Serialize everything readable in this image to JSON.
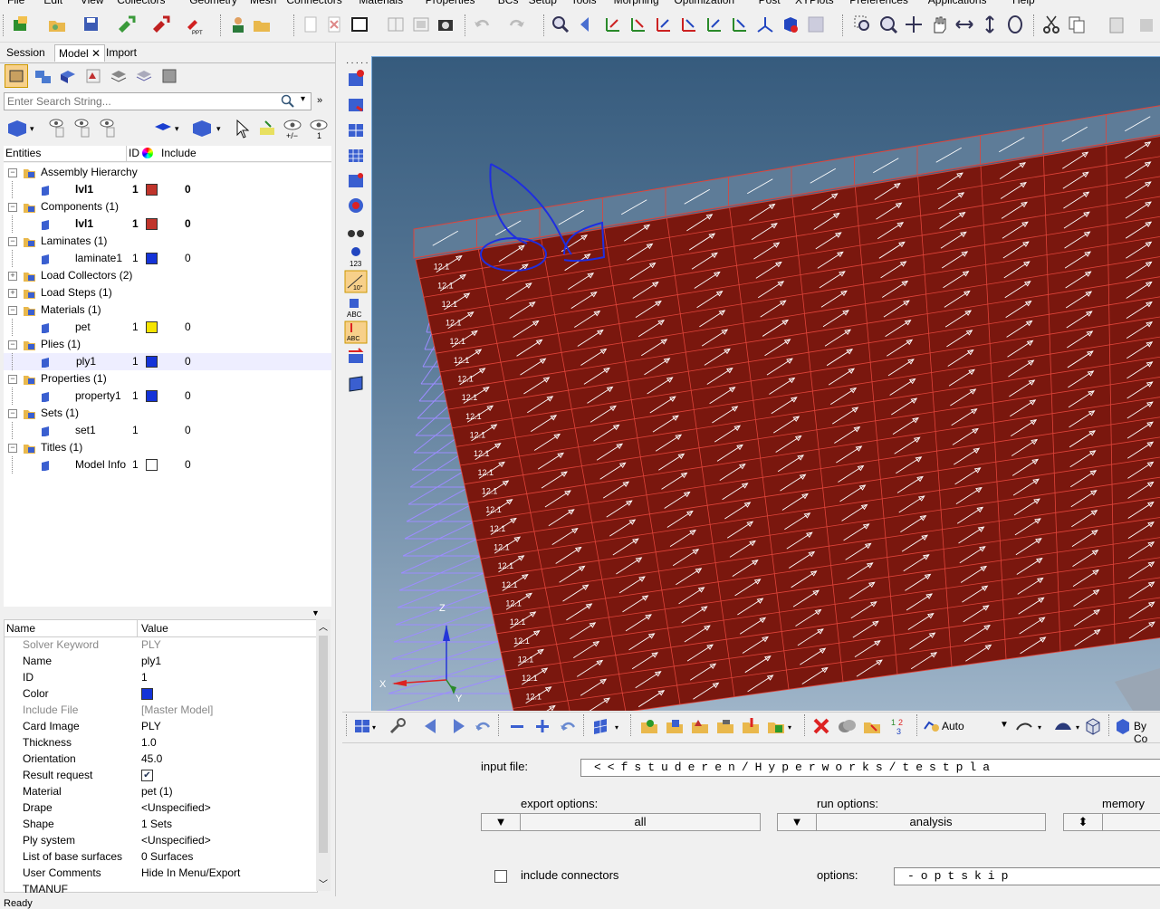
{
  "menus": [
    "File",
    "Edit",
    "View",
    "Collectors",
    "Geometry",
    "Mesh",
    "Connectors",
    "Materials",
    "Properties",
    "BCs",
    "Setup",
    "Tools",
    "Morphing",
    "Optimization",
    "Post",
    "XYPlots",
    "Preferences",
    "Applications",
    "Help"
  ],
  "tabs": {
    "session": "Session",
    "model": "Model",
    "import": "Import"
  },
  "search": {
    "placeholder": "Enter Search String..."
  },
  "columns": {
    "entities": "Entities",
    "id": "ID",
    "include": "Include"
  },
  "tree": [
    {
      "label": "Assembly Hierarchy",
      "level": 0,
      "id": "",
      "include": "",
      "color": ""
    },
    {
      "label": "lvl1",
      "level": 1,
      "id": "1",
      "include": "0",
      "color": "#c0342b",
      "bold": true
    },
    {
      "label": "Components (1)",
      "level": 0,
      "id": "",
      "include": "",
      "color": ""
    },
    {
      "label": "lvl1",
      "level": 1,
      "id": "1",
      "include": "0",
      "color": "#c0342b",
      "bold": true
    },
    {
      "label": "Laminates (1)",
      "level": 0,
      "id": "",
      "include": "",
      "color": ""
    },
    {
      "label": "laminate1",
      "level": 1,
      "id": "1",
      "include": "0",
      "color": "#1433d8"
    },
    {
      "label": "Load Collectors (2)",
      "level": 0,
      "id": "",
      "include": "",
      "color": ""
    },
    {
      "label": "Load Steps (1)",
      "level": 0,
      "id": "",
      "include": "",
      "color": ""
    },
    {
      "label": "Materials (1)",
      "level": 0,
      "id": "",
      "include": "",
      "color": ""
    },
    {
      "label": "pet",
      "level": 1,
      "id": "1",
      "include": "0",
      "color": "#f5e400"
    },
    {
      "label": "Plies (1)",
      "level": 0,
      "id": "",
      "include": "",
      "color": ""
    },
    {
      "label": "ply1",
      "level": 1,
      "id": "1",
      "include": "0",
      "color": "#1433d8",
      "selected": true
    },
    {
      "label": "Properties (1)",
      "level": 0,
      "id": "",
      "include": "",
      "color": ""
    },
    {
      "label": "property1",
      "level": 1,
      "id": "1",
      "include": "0",
      "color": "#1433d8"
    },
    {
      "label": "Sets (1)",
      "level": 0,
      "id": "",
      "include": "",
      "color": ""
    },
    {
      "label": "set1",
      "level": 1,
      "id": "1",
      "include": "0",
      "color": ""
    },
    {
      "label": "Titles (1)",
      "level": 0,
      "id": "",
      "include": "",
      "color": ""
    },
    {
      "label": "Model Info",
      "level": 1,
      "id": "1",
      "include": "0",
      "color": "#ffffff"
    }
  ],
  "props_header": {
    "name": "Name",
    "value": "Value"
  },
  "props": [
    {
      "name": "Solver Keyword",
      "value": "PLY",
      "grey": true
    },
    {
      "name": "Name",
      "value": "ply1"
    },
    {
      "name": "ID",
      "value": "1"
    },
    {
      "name": "Color",
      "value": "",
      "swatch": "#1433d8"
    },
    {
      "name": "Include File",
      "value": "[Master Model]",
      "grey": true
    },
    {
      "name": "Card Image",
      "value": "PLY"
    },
    {
      "name": "Thickness",
      "value": "1.0"
    },
    {
      "name": "Orientation",
      "value": "45.0"
    },
    {
      "name": "Result request",
      "value": "",
      "check": true
    },
    {
      "name": "Material",
      "value": "pet (1)"
    },
    {
      "name": "Drape",
      "value": "<Unspecified>"
    },
    {
      "name": "Shape",
      "value": "1 Sets"
    },
    {
      "name": "Ply system",
      "value": "<Unspecified>"
    },
    {
      "name": "List of base surfaces",
      "value": "0 Surfaces"
    },
    {
      "name": "User Comments",
      "value": "Hide In Menu/Export"
    },
    {
      "name": "TMANUF",
      "value": ""
    }
  ],
  "viewport": {
    "element_label": "12.1",
    "axis_z": "Z",
    "axis_y": "Y",
    "axis_x": "X"
  },
  "bottombar": {
    "auto": "Auto",
    "by_comp": "By Co"
  },
  "panel": {
    "input_file_label": "input file:",
    "input_file_value": "<<fstuderen/Hyperworks/testpla",
    "export_options_label": "export options:",
    "export_options_value": "all",
    "run_options_label": "run options:",
    "run_options_value": "analysis",
    "memory_label": "memory op",
    "include_connectors": "include connectors",
    "options_label": "options:",
    "options_value": "-optskip"
  },
  "status": "Ready",
  "colors": {
    "mesh": "#7a170e",
    "edge": "#e0443a",
    "ply_grid": "#9c8cff",
    "sketch": "#1f2ee0"
  }
}
